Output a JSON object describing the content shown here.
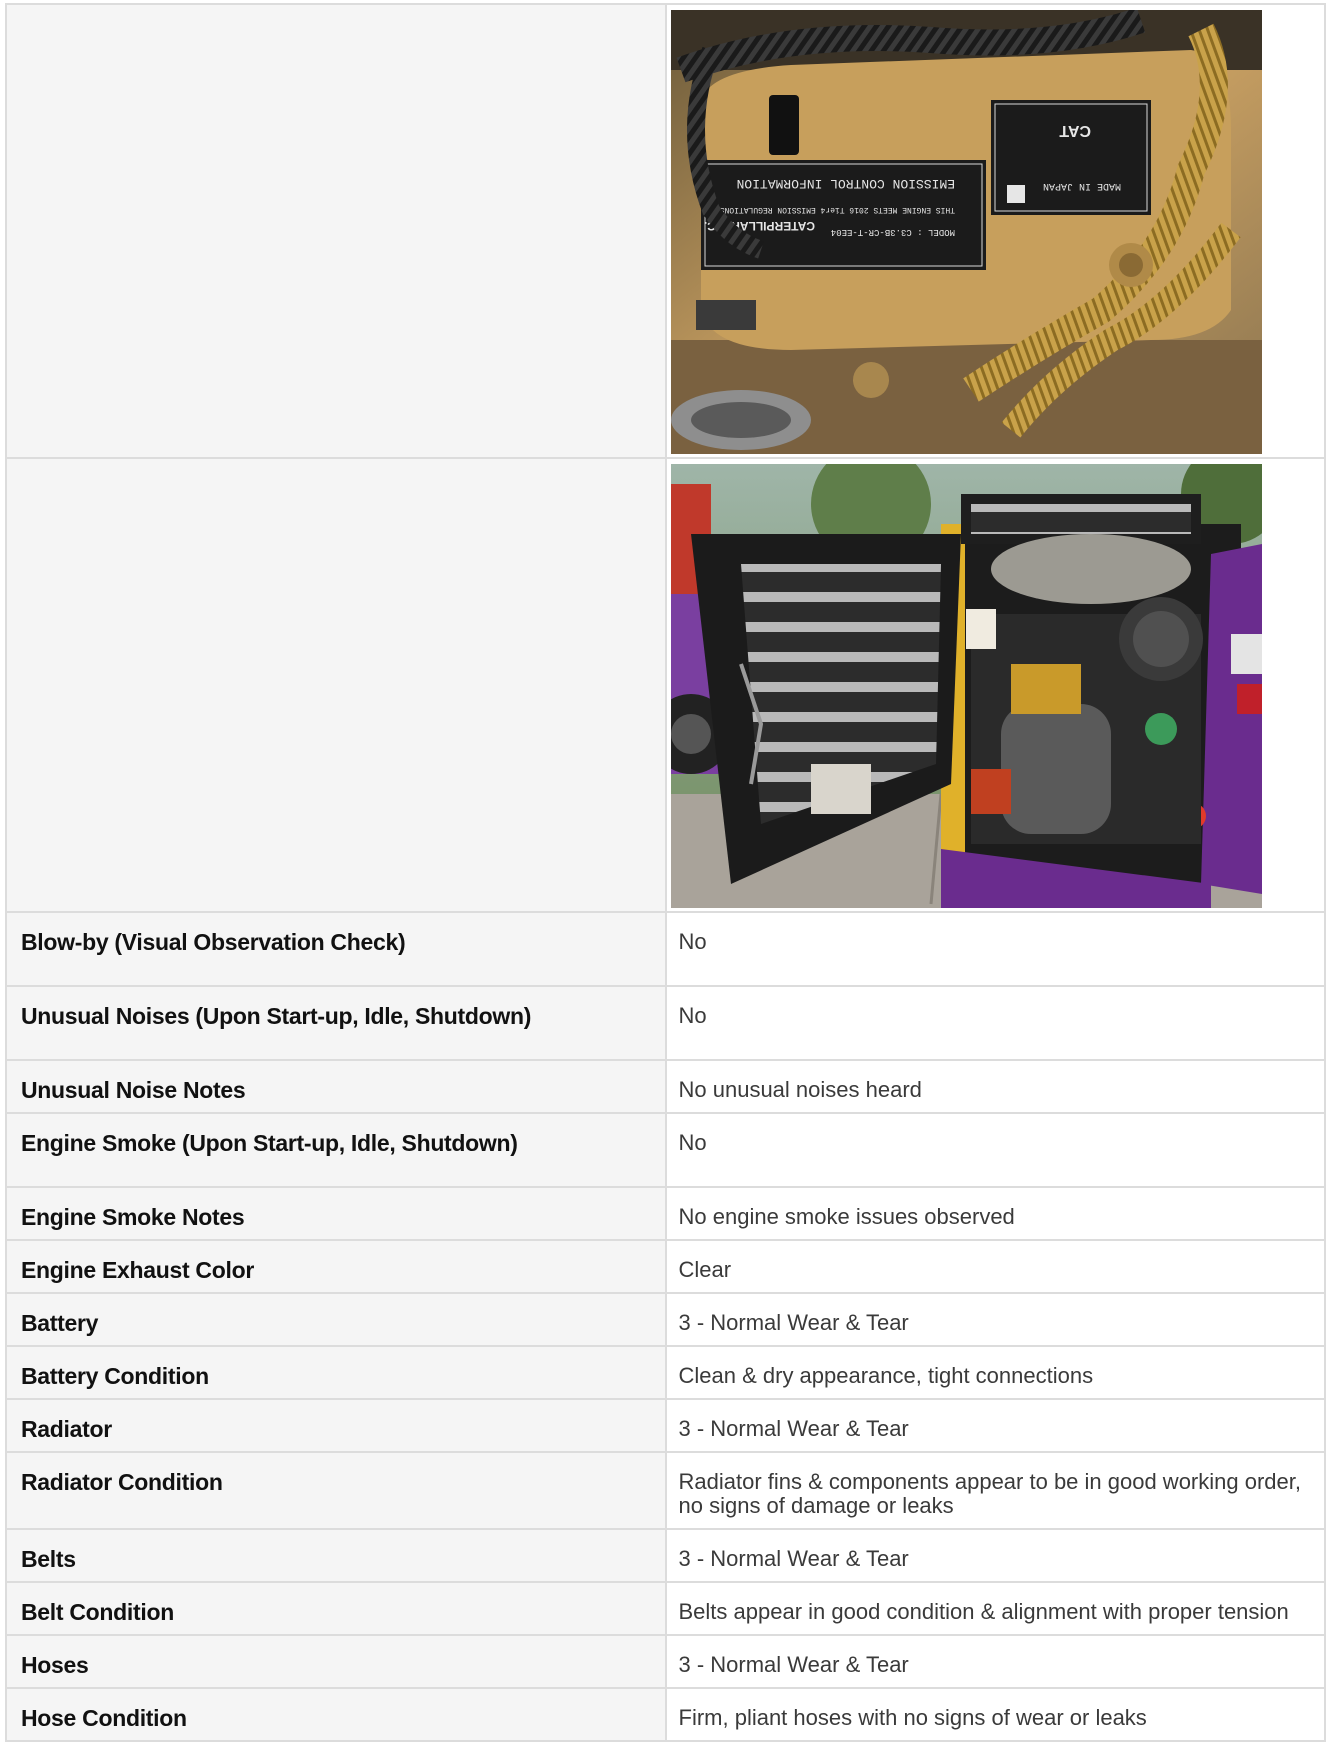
{
  "photos": [
    {
      "alt": "Engine emission control information label close-up"
    },
    {
      "alt": "Open rear engine compartment with radiator door"
    }
  ],
  "label_text": {
    "emission_title": "EMISSION CONTROL INFORMATION",
    "brand": "CAT",
    "maker": "CATERPILLAR INC.",
    "made_in": "MADE IN JAPAN",
    "meets": "THIS ENGINE MEETS 2016 Tier4 EMISSION REGULATIONS",
    "model": "MODEL : C3.3B-CR-T-EE04"
  },
  "rows": [
    {
      "label": "Blow-by (Visual Observation Check)",
      "value": "No"
    },
    {
      "label": "Unusual Noises (Upon Start-up, Idle, Shutdown)",
      "value": "No"
    },
    {
      "label": "Unusual Noise Notes",
      "value": "No unusual noises heard"
    },
    {
      "label": "Engine Smoke (Upon Start-up, Idle, Shutdown)",
      "value": "No"
    },
    {
      "label": "Engine Smoke Notes",
      "value": "No engine smoke issues observed"
    },
    {
      "label": "Engine Exhaust Color",
      "value": "Clear"
    },
    {
      "label": "Battery",
      "value": "3 - Normal Wear & Tear"
    },
    {
      "label": "Battery Condition",
      "value": "Clean & dry appearance, tight connections"
    },
    {
      "label": "Radiator",
      "value": "3 - Normal Wear & Tear"
    },
    {
      "label": "Radiator Condition",
      "value": "Radiator fins & components appear to be in good working order, no signs of damage or leaks"
    },
    {
      "label": "Belts",
      "value": "3 - Normal Wear & Tear"
    },
    {
      "label": "Belt Condition",
      "value": "Belts appear in good condition & alignment with proper tension"
    },
    {
      "label": "Hoses",
      "value": "3 - Normal Wear & Tear"
    },
    {
      "label": "Hose Condition",
      "value": "Firm, pliant hoses with no signs of wear or leaks"
    }
  ]
}
